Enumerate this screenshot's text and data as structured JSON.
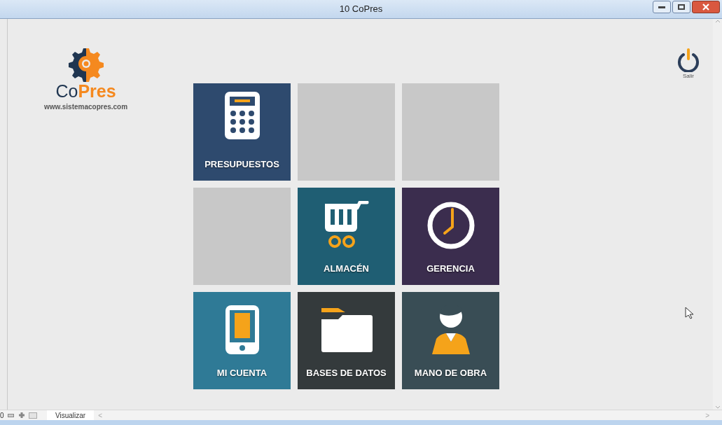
{
  "window": {
    "title": "10 CoPres"
  },
  "logo": {
    "name_dark": "Co",
    "name_accent": "Pres",
    "url": "www.sistemacopres.com"
  },
  "exit_button": {
    "label": "Salir"
  },
  "tiles": [
    {
      "kind": "calculator",
      "label": "PRESUPUESTOS",
      "color": "#2e4a6e"
    },
    {
      "kind": "empty",
      "color": "#c8c8c8"
    },
    {
      "kind": "empty",
      "color": "#c8c8c8"
    },
    {
      "kind": "empty",
      "color": "#c8c8c8"
    },
    {
      "kind": "cart",
      "label": "ALMACÉN",
      "color": "#1f5e73"
    },
    {
      "kind": "clock",
      "label": "GERENCIA",
      "color": "#3b2d4e"
    },
    {
      "kind": "phone",
      "label": "MI CUENTA",
      "color": "#2f7a96"
    },
    {
      "kind": "folder",
      "label": "BASES DE DATOS",
      "color": "#343a3c"
    },
    {
      "kind": "person",
      "label": "MANO DE OBRA",
      "color": "#394d55"
    }
  ],
  "status_bar": {
    "zoom": "0",
    "tab": "Visualizar",
    "scroll_left": "<",
    "scroll_right": ">"
  }
}
